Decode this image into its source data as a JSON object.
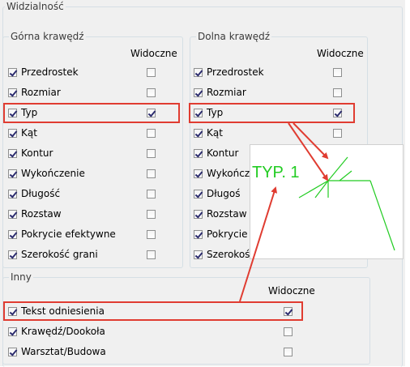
{
  "group_title": "Widzialność",
  "upper": {
    "title": "Górna krawędź",
    "visible_header": "Widoczne",
    "items": [
      {
        "label": "Przedrostek",
        "checked": true,
        "visible": false
      },
      {
        "label": "Rozmiar",
        "checked": true,
        "visible": false
      },
      {
        "label": "Typ",
        "checked": true,
        "visible": true
      },
      {
        "label": "Kąt",
        "checked": true,
        "visible": false
      },
      {
        "label": "Kontur",
        "checked": true,
        "visible": false
      },
      {
        "label": "Wykończenie",
        "checked": true,
        "visible": false
      },
      {
        "label": "Długość",
        "checked": true,
        "visible": false
      },
      {
        "label": "Rozstaw",
        "checked": true,
        "visible": false
      },
      {
        "label": "Pokrycie efektywne",
        "checked": true,
        "visible": false
      },
      {
        "label": "Szerokość grani",
        "checked": true,
        "visible": false
      }
    ]
  },
  "lower": {
    "title": "Dolna krawędź",
    "visible_header": "Widoczne",
    "items": [
      {
        "label": "Przedrostek",
        "checked": true,
        "visible": false
      },
      {
        "label": "Rozmiar",
        "checked": true,
        "visible": false
      },
      {
        "label": "Typ",
        "checked": true,
        "visible": true
      },
      {
        "label": "Kąt",
        "checked": true,
        "visible": false
      },
      {
        "label": "Kontur",
        "checked": true,
        "visible": false
      },
      {
        "label": "Wykończ",
        "checked": true,
        "visible": false
      },
      {
        "label": "Długoś",
        "checked": true,
        "visible": false
      },
      {
        "label": "Rozstaw",
        "checked": true,
        "visible": false
      },
      {
        "label": "Pokrycie e",
        "checked": true,
        "visible": false
      },
      {
        "label": "Szerokoś",
        "checked": true,
        "visible": false
      }
    ]
  },
  "other": {
    "title": "Inny",
    "visible_header": "Widoczne",
    "items": [
      {
        "label": "Tekst odniesienia",
        "checked": true,
        "visible": true
      },
      {
        "label": "Krawędź/Dookoła",
        "checked": true,
        "visible": false
      },
      {
        "label": "Warsztat/Budowa",
        "checked": true,
        "visible": false
      }
    ]
  },
  "preview": {
    "text": "TYP. 1",
    "line_color": "#22cc22"
  },
  "colors": {
    "highlight": "#e03c31",
    "panel_bg": "#f0f0f0"
  }
}
